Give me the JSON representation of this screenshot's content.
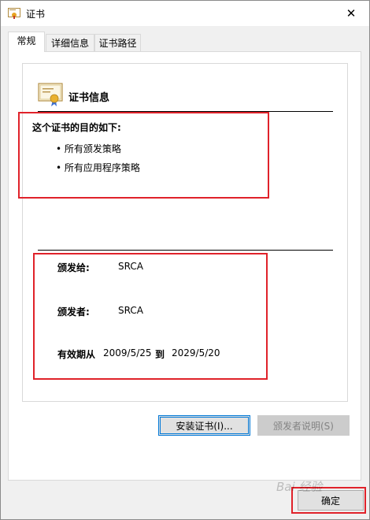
{
  "window": {
    "title": "证书",
    "close_glyph": "✕"
  },
  "tabs": [
    {
      "label": "常规",
      "active": true
    },
    {
      "label": "详细信息",
      "active": false
    },
    {
      "label": "证书路径",
      "active": false
    }
  ],
  "cert_info": {
    "heading": "证书信息",
    "purpose_title": "这个证书的目的如下:",
    "purposes": [
      "• 所有颁发策略",
      "• 所有应用程序策略"
    ]
  },
  "details": {
    "issued_to_label": "颁发给:",
    "issued_to_value": "SRCA",
    "issued_by_label": "颁发者:",
    "issued_by_value": "SRCA",
    "valid_from_label": "有效期从",
    "valid_from": "2009/5/25",
    "valid_to_label": "到",
    "valid_to": "2029/5/20"
  },
  "buttons": {
    "install": "安装证书(I)...",
    "issuer_statement": "颁发者说明(S)",
    "ok": "确定"
  },
  "watermark": "Bai 经验",
  "colors": {
    "highlight": "#e0222a",
    "focus": "#0078d7"
  }
}
